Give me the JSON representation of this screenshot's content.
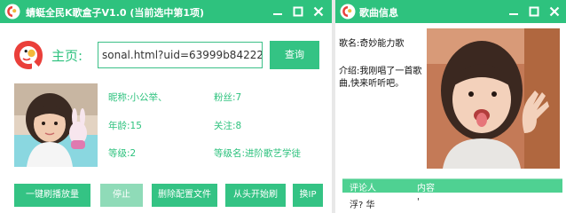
{
  "main_window": {
    "title": "蜻蜓全民K歌盒子V1.0 (当前选中第1项)",
    "home_label": "主页:",
    "url_value": "sonal.html?uid=63999b84222f3e8d",
    "query_button": "查询",
    "user": {
      "nickname": "昵称:小公举、",
      "fans": "粉丝:7",
      "age": "年龄:15",
      "following": "关注:8",
      "level": "等级:2",
      "level_name": "等级名:进阶歌艺学徒"
    },
    "actions": {
      "one_click_play": "一键刷播放量",
      "stop": "停止",
      "delete_config": "删除配置文件",
      "restart": "从头开始刷",
      "change_ip": "换IP"
    }
  },
  "song_window": {
    "title": "歌曲信息",
    "song_name": "歌名:奇妙能力歌",
    "intro_line1": "介绍:我刚唱了一首歌",
    "intro_line2": "曲,快来听听吧。",
    "comments": {
      "headers": [
        "评论人",
        "内容"
      ],
      "rows": [
        [
          "浮? 华",
          "'"
        ]
      ]
    }
  },
  "icons": {
    "minimize": "minimize-icon",
    "maximize": "maximize-icon",
    "close": "close-icon"
  },
  "colors": {
    "accent": "#2ec27e",
    "button": "#34c384",
    "button_disabled": "#8fdbb8"
  }
}
